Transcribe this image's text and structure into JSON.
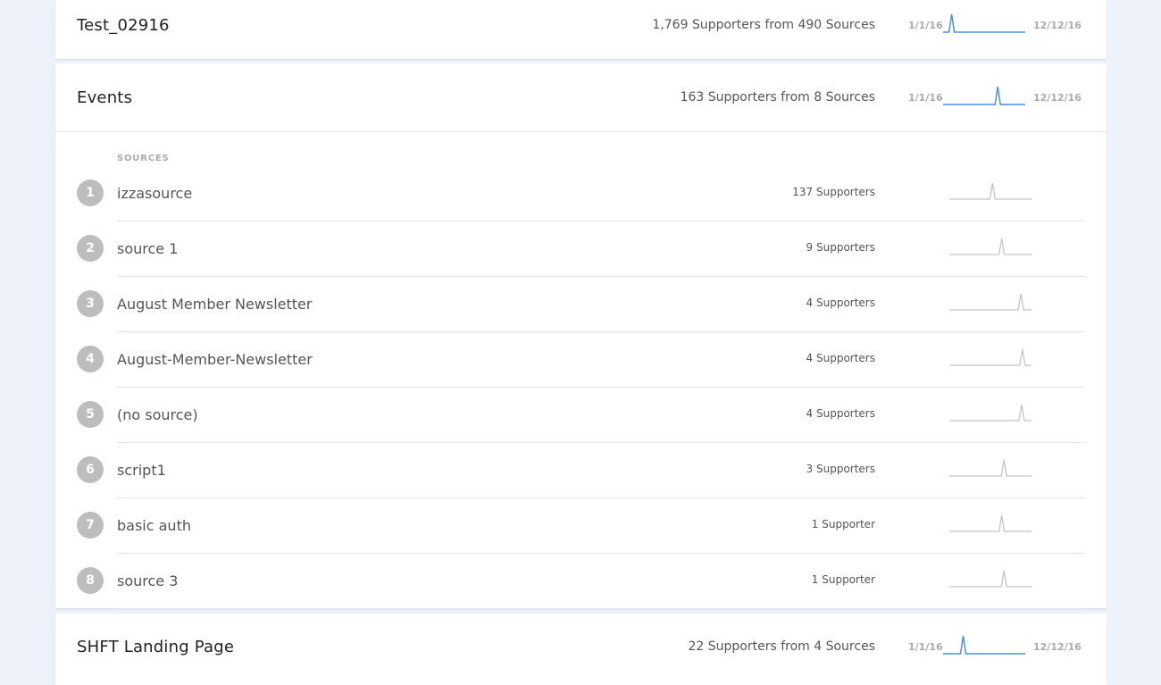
{
  "top_card": {
    "title": "Test_02916",
    "summary": "1,769 Supporters from 490 Sources",
    "date_start": "1/1/16",
    "date_end": "12/12/16",
    "spark_color": "#4a90e2",
    "spark_peak": 0.1
  },
  "events_card": {
    "title": "Events",
    "summary": "163 Supporters from 8 Sources",
    "date_start": "1/1/16",
    "date_end": "12/12/16",
    "spark_color": "#4a90e2",
    "spark_peak": 0.7,
    "sources_label": "SOURCES",
    "row_spark_color": "#c4c4c4",
    "rows": [
      {
        "num": "1",
        "name": "izzasource",
        "count": "137 Supporters",
        "peak": 0.55
      },
      {
        "num": "2",
        "name": "source 1",
        "count": "9 Supporters",
        "peak": 0.67
      },
      {
        "num": "3",
        "name": "August Member Newsletter",
        "count": "4 Supporters",
        "peak": 0.92
      },
      {
        "num": "4",
        "name": "August-Member-Newsletter",
        "count": "4 Supporters",
        "peak": 0.94
      },
      {
        "num": "5",
        "name": "(no source)",
        "count": "4 Supporters",
        "peak": 0.93
      },
      {
        "num": "6",
        "name": "script1",
        "count": "3 Supporters",
        "peak": 0.7
      },
      {
        "num": "7",
        "name": "basic auth",
        "count": "1 Supporter",
        "peak": 0.67
      },
      {
        "num": "8",
        "name": "source 3",
        "count": "1 Supporter",
        "peak": 0.7
      }
    ]
  },
  "bottom_card": {
    "title": "SHFT Landing Page",
    "summary": "22 Supporters from 4 Sources",
    "date_start": "1/1/16",
    "date_end": "12/12/16",
    "spark_color": "#4a90e2",
    "spark_peak": 0.25
  }
}
